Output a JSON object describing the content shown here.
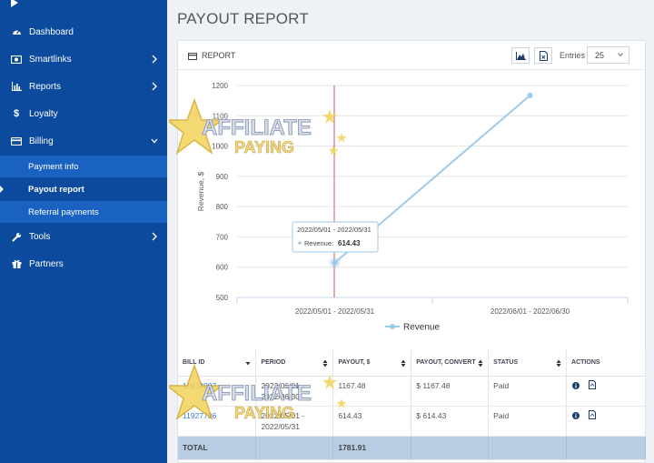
{
  "sidebar": {
    "items": [
      {
        "label": "Dashboard",
        "icon": "dashboard-icon"
      },
      {
        "label": "Smartlinks",
        "icon": "smartlinks-icon"
      },
      {
        "label": "Reports",
        "icon": "bar-chart-icon"
      },
      {
        "label": "Loyalty",
        "icon": "dollar-icon"
      },
      {
        "label": "Billing",
        "icon": "credit-card-icon"
      },
      {
        "label": "Tools",
        "icon": "wrench-icon"
      },
      {
        "label": "Partners",
        "icon": "gift-icon"
      }
    ],
    "billing_sub": [
      {
        "label": "Payment info"
      },
      {
        "label": "Payout report"
      },
      {
        "label": "Referral payments"
      }
    ]
  },
  "page": {
    "title": "PAYOUT REPORT"
  },
  "panel": {
    "title": "REPORT",
    "entries_label": "Entries",
    "entries_value": "25"
  },
  "chart_data": {
    "type": "line",
    "categories": [
      "2022/05/01 - 2022/05/31",
      "2022/06/01 - 2022/06/30"
    ],
    "series": [
      {
        "name": "Revenue",
        "values": [
          614.43,
          1167.48
        ],
        "color": "#9ccaea"
      }
    ],
    "ylabel": "Revenue, $",
    "ylim": [
      500,
      1200
    ],
    "yticks": [
      500,
      600,
      700,
      800,
      900,
      1000,
      1100,
      1200
    ],
    "grid": true,
    "legend": "bottom-center",
    "tooltip": {
      "title": "2022/05/01 - 2022/05/31",
      "series": "Revenue:",
      "value": "614.43"
    }
  },
  "table": {
    "headers": [
      "BILL ID",
      "PERIOD",
      "PAYOUT, $",
      "PAYOUT, CONVERT",
      "STATUS",
      "ACTIONS"
    ],
    "rows": [
      {
        "bill_id": "11932097",
        "period_1": "2022/06/01 -",
        "period_2": "2022/06/30",
        "payout": "1167.48",
        "convert": "$ 1167.48",
        "status": "Paid"
      },
      {
        "bill_id": "11927796",
        "period_1": "2022/05/01 -",
        "period_2": "2022/05/31",
        "payout": "614.43",
        "convert": "$ 614.43",
        "status": "Paid"
      }
    ],
    "total_label": "TOTAL",
    "total_value": "1781.91"
  },
  "watermark": {
    "line1": "AFFILIATE",
    "line2": "PAYING"
  }
}
